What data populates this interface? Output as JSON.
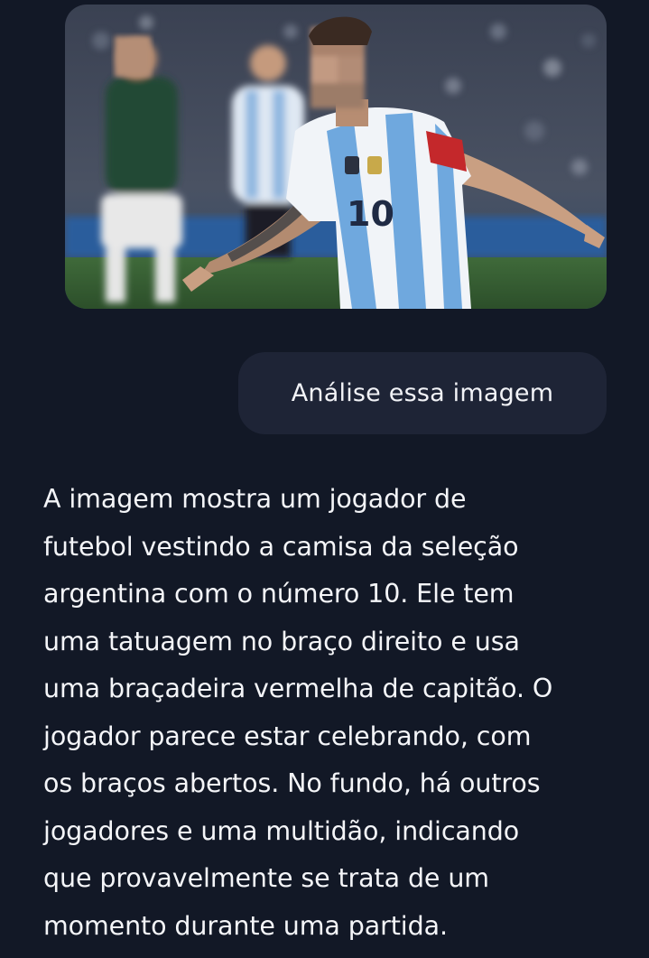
{
  "colors": {
    "background": "#121826",
    "bubble": "#1e2436",
    "text": "#f4f5f8"
  },
  "attachment": {
    "image_subject": "football player in Argentina national team jersey number 10 celebrating with arms open",
    "jersey_number": "10"
  },
  "user_message": {
    "text": "Análise essa imagem"
  },
  "assistant_reply": {
    "lines": [
      "A imagem mostra um jogador de",
      "futebol vestindo a camisa da seleção",
      "argentina com o número 10. Ele tem",
      "uma tatuagem no braço direito e usa",
      "uma braçadeira vermelha de capitão. O",
      "jogador parece estar celebrando, com",
      "os braços abertos. No fundo, há outros",
      "jogadores e uma multidão, indicando",
      "que provavelmente se trata de um",
      "momento durante uma partida."
    ]
  }
}
